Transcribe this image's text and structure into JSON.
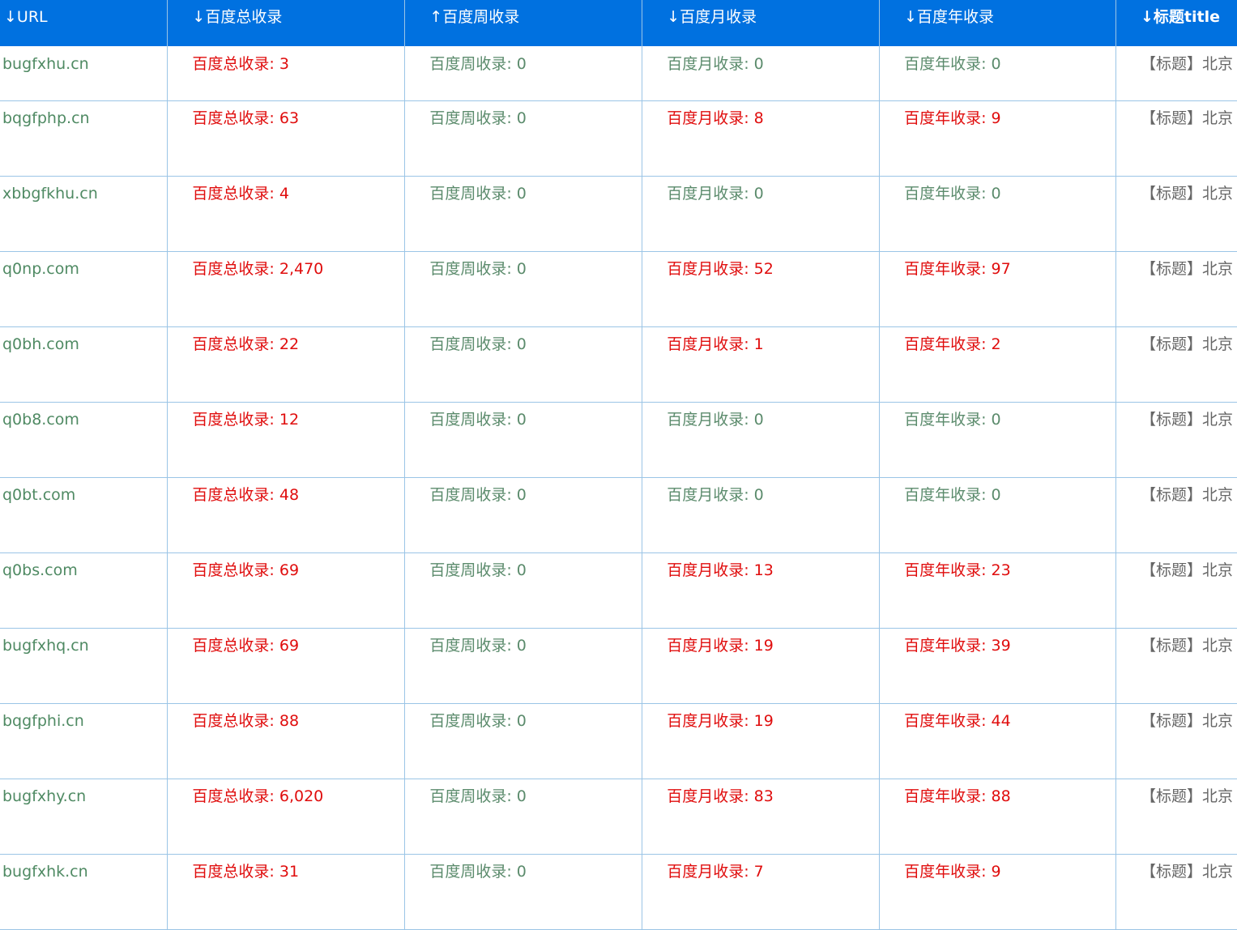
{
  "headers": [
    {
      "label": "↓URL"
    },
    {
      "label": "↓百度总收录"
    },
    {
      "label": "↑百度周收录"
    },
    {
      "label": "↓百度月收录"
    },
    {
      "label": "↓百度年收录"
    },
    {
      "label": "↓标题title"
    }
  ],
  "rows": [
    {
      "url": "bugfxhu.cn",
      "total": "百度总收录: 3",
      "week": "百度周收录: 0",
      "month": "百度月收录: 0",
      "year": "百度年收录: 0",
      "title": "【标题】北京"
    },
    {
      "url": "bqgfphp.cn",
      "total": "百度总收录: 63",
      "week": "百度周收录: 0",
      "month": "百度月收录: 8",
      "year": "百度年收录: 9",
      "title": "【标题】北京"
    },
    {
      "url": "xbbgfkhu.cn",
      "total": "百度总收录: 4",
      "week": "百度周收录: 0",
      "month": "百度月收录: 0",
      "year": "百度年收录: 0",
      "title": "【标题】北京"
    },
    {
      "url": "q0np.com",
      "total": "百度总收录: 2,470",
      "week": "百度周收录: 0",
      "month": "百度月收录: 52",
      "year": "百度年收录: 97",
      "title": "【标题】北京"
    },
    {
      "url": "q0bh.com",
      "total": "百度总收录: 22",
      "week": "百度周收录: 0",
      "month": "百度月收录: 1",
      "year": "百度年收录: 2",
      "title": "【标题】北京"
    },
    {
      "url": "q0b8.com",
      "total": "百度总收录: 12",
      "week": "百度周收录: 0",
      "month": "百度月收录: 0",
      "year": "百度年收录: 0",
      "title": "【标题】北京"
    },
    {
      "url": "q0bt.com",
      "total": "百度总收录: 48",
      "week": "百度周收录: 0",
      "month": "百度月收录: 0",
      "year": "百度年收录: 0",
      "title": "【标题】北京"
    },
    {
      "url": "q0bs.com",
      "total": "百度总收录: 69",
      "week": "百度周收录: 0",
      "month": "百度月收录: 13",
      "year": "百度年收录: 23",
      "title": "【标题】北京"
    },
    {
      "url": "bugfxhq.cn",
      "total": "百度总收录: 69",
      "week": "百度周收录: 0",
      "month": "百度月收录: 19",
      "year": "百度年收录: 39",
      "title": "【标题】北京"
    },
    {
      "url": "bqgfphi.cn",
      "total": "百度总收录: 88",
      "week": "百度周收录: 0",
      "month": "百度月收录: 19",
      "year": "百度年收录: 44",
      "title": "【标题】北京"
    },
    {
      "url": "bugfxhy.cn",
      "total": "百度总收录: 6,020",
      "week": "百度周收录: 0",
      "month": "百度月收录: 83",
      "year": "百度年收录: 88",
      "title": "【标题】北京"
    },
    {
      "url": "bugfxhk.cn",
      "total": "百度总收录: 31",
      "week": "百度周收录: 0",
      "month": "百度月收录: 7",
      "year": "百度年收录: 9",
      "title": "【标题】北京"
    }
  ],
  "colors": {
    "header_bg": "#0071e0",
    "positive": "#e00d0d",
    "zero": "#5b8b6c",
    "url": "#4f8a63",
    "grid": "#9bc5e6"
  }
}
